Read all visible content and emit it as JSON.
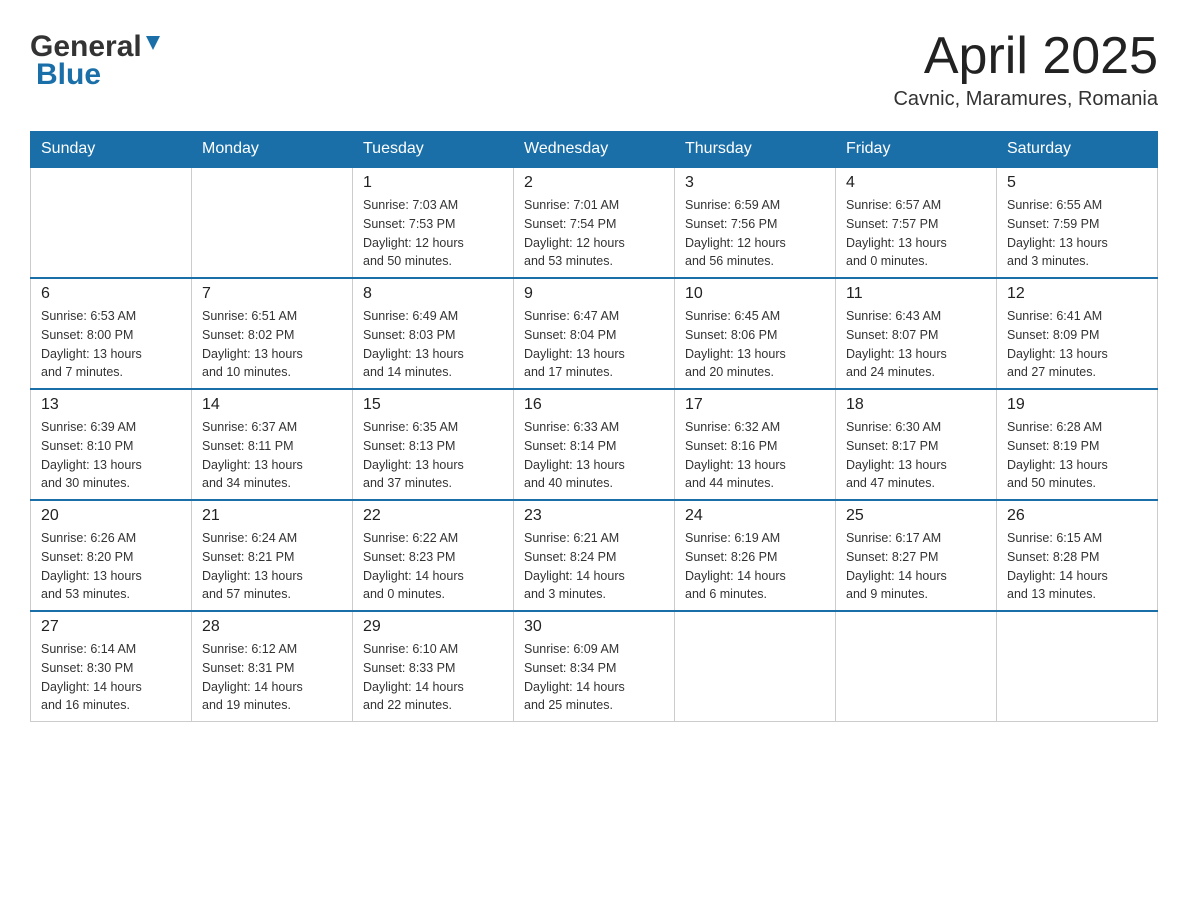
{
  "header": {
    "title": "April 2025",
    "subtitle": "Cavnic, Maramures, Romania",
    "logo_general": "General",
    "logo_blue": "Blue"
  },
  "columns": [
    "Sunday",
    "Monday",
    "Tuesday",
    "Wednesday",
    "Thursday",
    "Friday",
    "Saturday"
  ],
  "weeks": [
    [
      {
        "day": "",
        "info": ""
      },
      {
        "day": "",
        "info": ""
      },
      {
        "day": "1",
        "info": "Sunrise: 7:03 AM\nSunset: 7:53 PM\nDaylight: 12 hours\nand 50 minutes."
      },
      {
        "day": "2",
        "info": "Sunrise: 7:01 AM\nSunset: 7:54 PM\nDaylight: 12 hours\nand 53 minutes."
      },
      {
        "day": "3",
        "info": "Sunrise: 6:59 AM\nSunset: 7:56 PM\nDaylight: 12 hours\nand 56 minutes."
      },
      {
        "day": "4",
        "info": "Sunrise: 6:57 AM\nSunset: 7:57 PM\nDaylight: 13 hours\nand 0 minutes."
      },
      {
        "day": "5",
        "info": "Sunrise: 6:55 AM\nSunset: 7:59 PM\nDaylight: 13 hours\nand 3 minutes."
      }
    ],
    [
      {
        "day": "6",
        "info": "Sunrise: 6:53 AM\nSunset: 8:00 PM\nDaylight: 13 hours\nand 7 minutes."
      },
      {
        "day": "7",
        "info": "Sunrise: 6:51 AM\nSunset: 8:02 PM\nDaylight: 13 hours\nand 10 minutes."
      },
      {
        "day": "8",
        "info": "Sunrise: 6:49 AM\nSunset: 8:03 PM\nDaylight: 13 hours\nand 14 minutes."
      },
      {
        "day": "9",
        "info": "Sunrise: 6:47 AM\nSunset: 8:04 PM\nDaylight: 13 hours\nand 17 minutes."
      },
      {
        "day": "10",
        "info": "Sunrise: 6:45 AM\nSunset: 8:06 PM\nDaylight: 13 hours\nand 20 minutes."
      },
      {
        "day": "11",
        "info": "Sunrise: 6:43 AM\nSunset: 8:07 PM\nDaylight: 13 hours\nand 24 minutes."
      },
      {
        "day": "12",
        "info": "Sunrise: 6:41 AM\nSunset: 8:09 PM\nDaylight: 13 hours\nand 27 minutes."
      }
    ],
    [
      {
        "day": "13",
        "info": "Sunrise: 6:39 AM\nSunset: 8:10 PM\nDaylight: 13 hours\nand 30 minutes."
      },
      {
        "day": "14",
        "info": "Sunrise: 6:37 AM\nSunset: 8:11 PM\nDaylight: 13 hours\nand 34 minutes."
      },
      {
        "day": "15",
        "info": "Sunrise: 6:35 AM\nSunset: 8:13 PM\nDaylight: 13 hours\nand 37 minutes."
      },
      {
        "day": "16",
        "info": "Sunrise: 6:33 AM\nSunset: 8:14 PM\nDaylight: 13 hours\nand 40 minutes."
      },
      {
        "day": "17",
        "info": "Sunrise: 6:32 AM\nSunset: 8:16 PM\nDaylight: 13 hours\nand 44 minutes."
      },
      {
        "day": "18",
        "info": "Sunrise: 6:30 AM\nSunset: 8:17 PM\nDaylight: 13 hours\nand 47 minutes."
      },
      {
        "day": "19",
        "info": "Sunrise: 6:28 AM\nSunset: 8:19 PM\nDaylight: 13 hours\nand 50 minutes."
      }
    ],
    [
      {
        "day": "20",
        "info": "Sunrise: 6:26 AM\nSunset: 8:20 PM\nDaylight: 13 hours\nand 53 minutes."
      },
      {
        "day": "21",
        "info": "Sunrise: 6:24 AM\nSunset: 8:21 PM\nDaylight: 13 hours\nand 57 minutes."
      },
      {
        "day": "22",
        "info": "Sunrise: 6:22 AM\nSunset: 8:23 PM\nDaylight: 14 hours\nand 0 minutes."
      },
      {
        "day": "23",
        "info": "Sunrise: 6:21 AM\nSunset: 8:24 PM\nDaylight: 14 hours\nand 3 minutes."
      },
      {
        "day": "24",
        "info": "Sunrise: 6:19 AM\nSunset: 8:26 PM\nDaylight: 14 hours\nand 6 minutes."
      },
      {
        "day": "25",
        "info": "Sunrise: 6:17 AM\nSunset: 8:27 PM\nDaylight: 14 hours\nand 9 minutes."
      },
      {
        "day": "26",
        "info": "Sunrise: 6:15 AM\nSunset: 8:28 PM\nDaylight: 14 hours\nand 13 minutes."
      }
    ],
    [
      {
        "day": "27",
        "info": "Sunrise: 6:14 AM\nSunset: 8:30 PM\nDaylight: 14 hours\nand 16 minutes."
      },
      {
        "day": "28",
        "info": "Sunrise: 6:12 AM\nSunset: 8:31 PM\nDaylight: 14 hours\nand 19 minutes."
      },
      {
        "day": "29",
        "info": "Sunrise: 6:10 AM\nSunset: 8:33 PM\nDaylight: 14 hours\nand 22 minutes."
      },
      {
        "day": "30",
        "info": "Sunrise: 6:09 AM\nSunset: 8:34 PM\nDaylight: 14 hours\nand 25 minutes."
      },
      {
        "day": "",
        "info": ""
      },
      {
        "day": "",
        "info": ""
      },
      {
        "day": "",
        "info": ""
      }
    ]
  ]
}
